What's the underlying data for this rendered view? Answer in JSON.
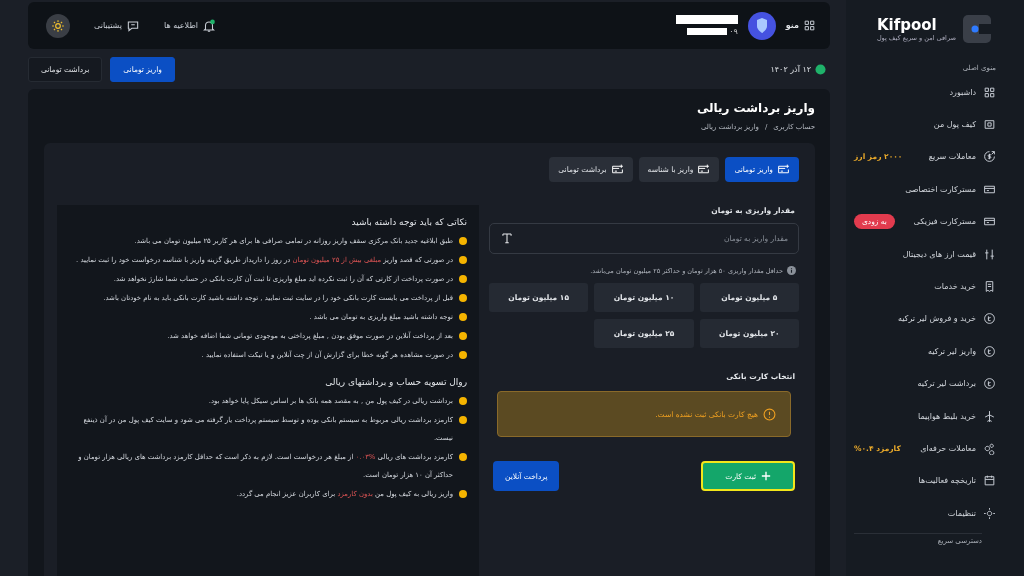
{
  "sidebar": {
    "logo": "Kifpool",
    "tagline": "صرافی امن و سریع کیف پول",
    "section": "منوی اصلی",
    "items": [
      {
        "label": "داشبورد"
      },
      {
        "label": "کیف پول من"
      },
      {
        "label": "معاملات سریع",
        "badge": {
          "text": "۲۰۰۰ رمز ارز",
          "kind": "note"
        }
      },
      {
        "label": "مسترکارت اختصاصی"
      },
      {
        "label": "مسترکارت فیزیکی",
        "badge": {
          "text": "به زودی",
          "kind": "pill"
        }
      },
      {
        "label": "قیمت ارز های دیجیتال"
      },
      {
        "label": "خرید خدمات"
      },
      {
        "label": "خرید و فروش لیر ترکیه"
      },
      {
        "label": "واریز لیر ترکیه"
      },
      {
        "label": "برداشت لیر ترکیه"
      },
      {
        "label": "خرید بلیط هواپیما"
      },
      {
        "label": "معاملات حرفه‌ای",
        "badge": {
          "text": "کارمزد ۰.۴%",
          "kind": "note"
        }
      },
      {
        "label": "تاریخچه فعالیت‌ها"
      },
      {
        "label": "تنظیمات"
      }
    ],
    "footer": "دسترسی سریع"
  },
  "header": {
    "menu": "منو",
    "user_phone": "۰۹",
    "notifications": "اطلاعیه ها",
    "support": "پشتیبانی"
  },
  "date": "۱۲ آذر ۱۴۰۲",
  "top_buttons": [
    {
      "label": "واریز تومانی",
      "selected": true
    },
    {
      "label": "برداشت تومانی",
      "selected": false
    }
  ],
  "page": {
    "title": "واریز برداشت ریالی",
    "breadcrumb": [
      "حساب کاربری",
      "واریز برداشت ریالی"
    ],
    "breadcrumb_separator": "/"
  },
  "tabs": [
    {
      "label": "واریز تومانی",
      "selected": true
    },
    {
      "label": "واریز با شناسه",
      "selected": false
    },
    {
      "label": "برداشت تومانی",
      "selected": false
    }
  ],
  "form": {
    "amount_label": "مقدار واریزی به تومان",
    "placeholder": "مقدار واریز به تومان",
    "hint": "حداقل مقدار واریزی ۵۰ هزار تومان و حداکثر ۲۵ میلیون تومان می‌باشد.",
    "amounts": [
      "۵ میلیون تومان",
      "۱۰ میلیون تومان",
      "۱۵ میلیون تومان",
      "۲۰ میلیون تومان",
      "۲۵ میلیون تومان"
    ],
    "card_label": "انتخاب کارت بانکی",
    "warning": "هیچ کارت بانکی ثبت نشده است.",
    "add_card": "ثبت کارت",
    "pay_online": "پرداخت آنلاین"
  },
  "notes": [
    {
      "title": "نکاتی که باید توجه داشته باشید",
      "items": [
        [
          {
            "text": "طبق ابلاغیه جدید بانک مرکزی سقف واریز روزانه در تمامی صرافی ها برای هر کاربر ۲۵ میلیون تومان می باشد.",
            "highlight": false
          }
        ],
        [
          {
            "text": "در صورتی که قصد واریز ",
            "highlight": false
          },
          {
            "text": "مبلغی بیش از ۲۵ میلیون تومان",
            "highlight": true
          },
          {
            "text": " در روز را داریداز طریق گزینه واریز با شناسه درخواست خود را ثبت نمایید .",
            "highlight": false
          }
        ],
        [
          {
            "text": "در صورت پرداخت از کارتی که آن را ثبت نکرده اید مبلغ واریزی تا ثبت آن کارت بانکی در حساب شما شارژ نخواهد شد.",
            "highlight": false
          }
        ],
        [
          {
            "text": "قبل از پرداخت می بایست کارت بانکی خود را در سایت ثبت نمایید , توجه داشته باشید کارت بانکی باید به نام خودتان باشد.",
            "highlight": false
          }
        ],
        [
          {
            "text": "توجه داشته باشید مبلغ واریزی به تومان می باشد .",
            "highlight": false
          }
        ],
        [
          {
            "text": "بعد از پرداخت آنلاین در صورت موفق بودن , مبلغ پرداختی به موجودی تومانی شما اضافه خواهد شد.",
            "highlight": false
          }
        ],
        [
          {
            "text": "در صورت مشاهده هر گونه خطا برای گزارش آن از چت آنلاین و یا تیکت استفاده نمایید .",
            "highlight": false
          }
        ]
      ]
    },
    {
      "title": "روال تسویه حساب و برداشتهای ریالی",
      "items": [
        [
          {
            "text": "برداشت ریالی در کیف پول من , به مقصد همه بانک ها بر اساس سیکل پایا خواهد بود.",
            "highlight": false
          }
        ],
        [
          {
            "text": "کارمزد برداشت ریالی مربوط به سیستم بانکی بوده و توسط سیستم پرداخت یار گرفته می شود و سایت کیف پول من در آن ذینفع نیست.",
            "highlight": false
          }
        ],
        [
          {
            "text": "کارمزد برداشت های ریالی ",
            "highlight": false
          },
          {
            "text": "%۰.۰۳",
            "highlight": true
          },
          {
            "text": " از مبلغ هر درخواست است. لازم به ذکر است که حداقل کارمزد برداشت های ریالی هزار تومان و حداکثر آن ۱۰ هزار تومان است.",
            "highlight": false
          }
        ],
        [
          {
            "text": "واریز ریالی به کیف پول من ",
            "highlight": false
          },
          {
            "text": "بدون کارمزد",
            "highlight": true
          },
          {
            "text": " برای کاربران عزیز انجام می گردد.",
            "highlight": false
          }
        ]
      ]
    }
  ]
}
